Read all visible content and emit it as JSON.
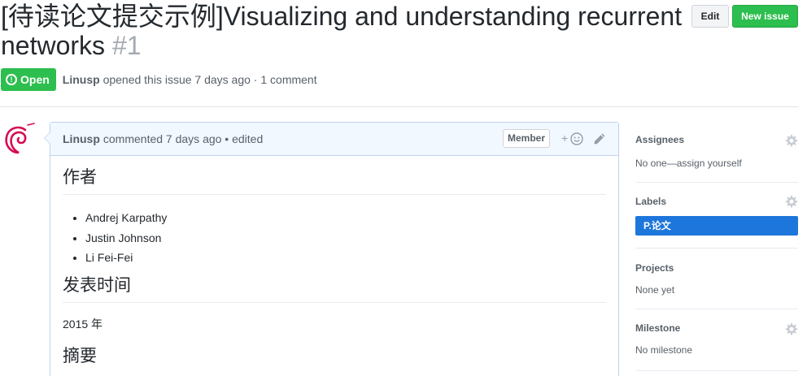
{
  "issue": {
    "title": "[待读论文提交示例]Visualizing and understanding recurrent networks",
    "number": "#1",
    "state": "Open",
    "author": "Linusp",
    "meta_text": "opened this issue 7 days ago · 1 comment"
  },
  "header_buttons": {
    "edit_label": "Edit",
    "new_issue_label": "New issue"
  },
  "comment": {
    "author": "Linusp",
    "meta": "commented 7 days ago • edited",
    "badge": "Member",
    "react_label": "+",
    "body": {
      "authors_heading": "作者",
      "authors": [
        "Andrej Karpathy",
        "Justin Johnson",
        "Li Fei-Fei"
      ],
      "date_heading": "发表时间",
      "date": "2015 年",
      "abstract_heading": "摘要"
    }
  },
  "sidebar": {
    "assignees": {
      "heading": "Assignees",
      "text": "No one—assign yourself"
    },
    "labels": {
      "heading": "Labels",
      "items": [
        "P.论文"
      ]
    },
    "projects": {
      "heading": "Projects",
      "text": "None yet"
    },
    "milestone": {
      "heading": "Milestone",
      "text": "No milestone"
    }
  },
  "colors": {
    "open_green": "#2cbe4e",
    "label_blue": "#1d76db",
    "comment_header_bg": "#f1f8ff",
    "avatar_red": "#d70a53"
  },
  "icons": [
    "issue-opened-icon",
    "debian-avatar-icon",
    "smiley-icon",
    "pencil-icon",
    "gear-icon"
  ]
}
